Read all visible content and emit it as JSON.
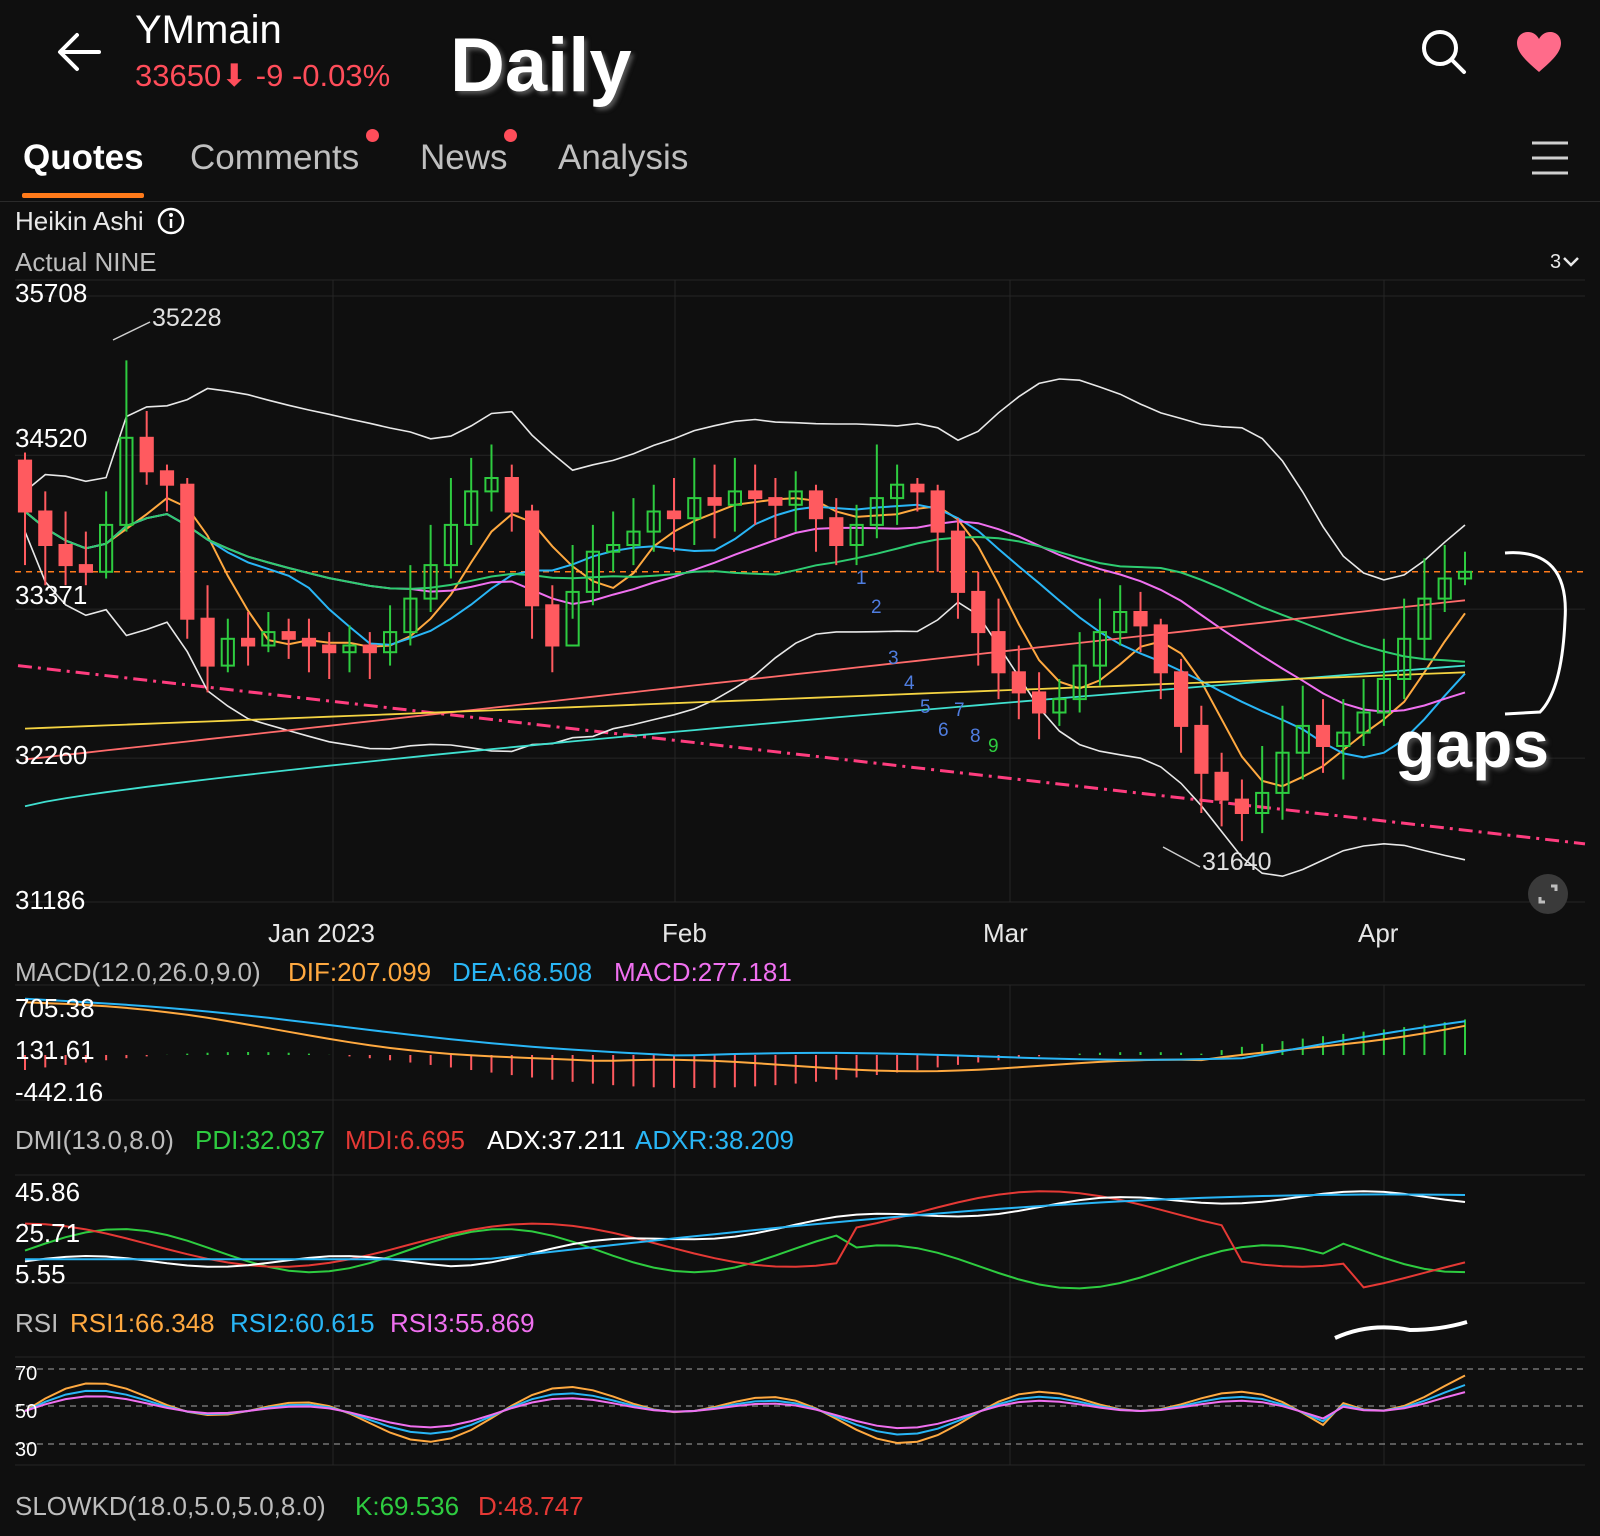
{
  "header": {
    "symbol": "YMmain",
    "price_line": "33650⬇ -9 -0.03%",
    "overlay_title": "Daily"
  },
  "tabs": [
    {
      "label": "Quotes",
      "active": true,
      "badge": false
    },
    {
      "label": "Comments",
      "active": false,
      "badge": true
    },
    {
      "label": "News",
      "active": false,
      "badge": true
    },
    {
      "label": "Analysis",
      "active": false,
      "badge": false
    }
  ],
  "chart_header": {
    "chart_style": "Heikin Ashi",
    "sub_labels": "Actual  NINE",
    "range_selector": "3"
  },
  "colors": {
    "up": "#2ecc40",
    "down": "#ff5a5f",
    "accent": "#ff7a1a",
    "orange": "#ffa940",
    "cyan": "#29b6f6",
    "pink": "#f070f0",
    "trendline": "#ff3d7f",
    "heart": "#ff6b8a"
  },
  "chart_data": [
    {
      "type": "candlestick",
      "style": "Heikin Ashi",
      "y_ticks": [
        "35708",
        "34520",
        "33371",
        "32260",
        "31186"
      ],
      "ylim": [
        31186,
        35708
      ],
      "x_ticks": [
        "Jan 2023",
        "Feb",
        "Mar",
        "Apr"
      ],
      "annotations": {
        "high": "35228",
        "low": "31640",
        "td_count": [
          "1",
          "2",
          "3",
          "4",
          "5",
          "6",
          "7",
          "8",
          "9"
        ],
        "handwritten_note": "gaps"
      },
      "current_price_line": 33650,
      "candles": [
        [
          34480,
          34100,
          34540,
          33700
        ],
        [
          34100,
          33850,
          34250,
          33550
        ],
        [
          33850,
          33700,
          34100,
          33550
        ],
        [
          33700,
          33650,
          33950,
          33550
        ],
        [
          33650,
          34000,
          34250,
          33600
        ],
        [
          34000,
          34650,
          35228,
          33950
        ],
        [
          34650,
          34400,
          34850,
          34300
        ],
        [
          34400,
          34300,
          34450,
          34100
        ],
        [
          34300,
          33300,
          34350,
          33150
        ],
        [
          33300,
          32950,
          33550,
          32750
        ],
        [
          32950,
          33150,
          33300,
          32900
        ],
        [
          33150,
          33100,
          33350,
          32950
        ],
        [
          33100,
          33200,
          33350,
          33050
        ],
        [
          33200,
          33150,
          33300,
          33000
        ],
        [
          33150,
          33100,
          33300,
          32900
        ],
        [
          33100,
          33050,
          33200,
          32850
        ],
        [
          33050,
          33100,
          33250,
          32900
        ],
        [
          33100,
          33050,
          33200,
          32850
        ],
        [
          33050,
          33200,
          33400,
          32950
        ],
        [
          33200,
          33450,
          33700,
          33100
        ],
        [
          33450,
          33700,
          34000,
          33350
        ],
        [
          33700,
          34000,
          34350,
          33600
        ],
        [
          34000,
          34250,
          34500,
          33850
        ],
        [
          34250,
          34350,
          34600,
          34100
        ],
        [
          34350,
          34100,
          34450,
          33950
        ],
        [
          34100,
          33400,
          34150,
          33150
        ],
        [
          33400,
          33100,
          33550,
          32900
        ],
        [
          33100,
          33500,
          33850,
          33300
        ],
        [
          33500,
          33800,
          34000,
          33400
        ],
        [
          33800,
          33850,
          34100,
          33650
        ],
        [
          33850,
          33950,
          34200,
          33700
        ],
        [
          33950,
          34100,
          34300,
          33800
        ],
        [
          34100,
          34050,
          34350,
          33800
        ],
        [
          34050,
          34200,
          34500,
          33850
        ],
        [
          34200,
          34150,
          34450,
          33900
        ],
        [
          34150,
          34250,
          34500,
          33950
        ],
        [
          34250,
          34200,
          34450,
          34000
        ],
        [
          34200,
          34150,
          34350,
          33900
        ],
        [
          34150,
          34250,
          34400,
          33950
        ],
        [
          34250,
          34050,
          34300,
          33800
        ],
        [
          34050,
          33850,
          34200,
          33700
        ],
        [
          33850,
          34000,
          34150,
          33700
        ],
        [
          34000,
          34200,
          34600,
          33900
        ],
        [
          34200,
          34300,
          34450,
          34000
        ],
        [
          34300,
          34250,
          34350,
          34100
        ],
        [
          34250,
          33950,
          34300,
          33650
        ],
        [
          33950,
          33500,
          34050,
          33300
        ],
        [
          33500,
          33200,
          33650,
          32950
        ],
        [
          33200,
          32900,
          33450,
          32700
        ],
        [
          32900,
          32750,
          33100,
          32550
        ],
        [
          32750,
          32600,
          32900,
          32400
        ],
        [
          32600,
          32700,
          32850,
          32500
        ],
        [
          32700,
          32950,
          33200,
          32600
        ],
        [
          32950,
          33200,
          33450,
          32800
        ],
        [
          33200,
          33350,
          33550,
          33100
        ],
        [
          33350,
          33250,
          33500,
          33050
        ],
        [
          33250,
          32900,
          33300,
          32700
        ],
        [
          32900,
          32500,
          33000,
          32300
        ],
        [
          32500,
          32150,
          32650,
          31850
        ],
        [
          32150,
          31950,
          32300,
          31750
        ],
        [
          31950,
          31850,
          32100,
          31640
        ],
        [
          31850,
          32000,
          32350,
          31700
        ],
        [
          32000,
          32300,
          32650,
          31800
        ],
        [
          32300,
          32500,
          32800,
          32100
        ],
        [
          32500,
          32350,
          32700,
          32150
        ],
        [
          32350,
          32450,
          32700,
          32100
        ],
        [
          32450,
          32600,
          32850,
          32350
        ],
        [
          32600,
          32850,
          33150,
          32500
        ],
        [
          32850,
          33150,
          33450,
          32700
        ],
        [
          33150,
          33450,
          33750,
          33000
        ],
        [
          33450,
          33600,
          33850,
          33350
        ],
        [
          33600,
          33650,
          33800,
          33550
        ]
      ]
    },
    {
      "type": "line",
      "name": "MACD(12.0,26.0,9.0)",
      "series": [
        {
          "name": "DIF",
          "value": "207.099"
        },
        {
          "name": "DEA",
          "value": "68.508"
        },
        {
          "name": "MACD",
          "value": "277.181"
        }
      ],
      "y_ticks": [
        "705.38",
        "131.61",
        "-442.16"
      ],
      "ylim": [
        -442.16,
        705.38
      ]
    },
    {
      "type": "line",
      "name": "DMI(13.0,8.0)",
      "series": [
        {
          "name": "PDI",
          "value": "32.037"
        },
        {
          "name": "MDI",
          "value": "6.695"
        },
        {
          "name": "ADX",
          "value": "37.211"
        },
        {
          "name": "ADXR",
          "value": "38.209"
        }
      ],
      "y_ticks": [
        "45.86",
        "25.71",
        "5.55"
      ],
      "ylim": [
        5.55,
        45.86
      ]
    },
    {
      "type": "line",
      "name": "RSI",
      "series": [
        {
          "name": "RSI1",
          "value": "66.348"
        },
        {
          "name": "RSI2",
          "value": "60.615"
        },
        {
          "name": "RSI3",
          "value": "55.869"
        }
      ],
      "y_ticks": [
        "70",
        "50",
        "30"
      ],
      "ylim": [
        20,
        80
      ]
    },
    {
      "type": "line",
      "name": "SLOWKD(18.0,5.0,5.0,8.0)",
      "series": [
        {
          "name": "K",
          "value": "69.536"
        },
        {
          "name": "D",
          "value": "48.747"
        }
      ]
    }
  ]
}
